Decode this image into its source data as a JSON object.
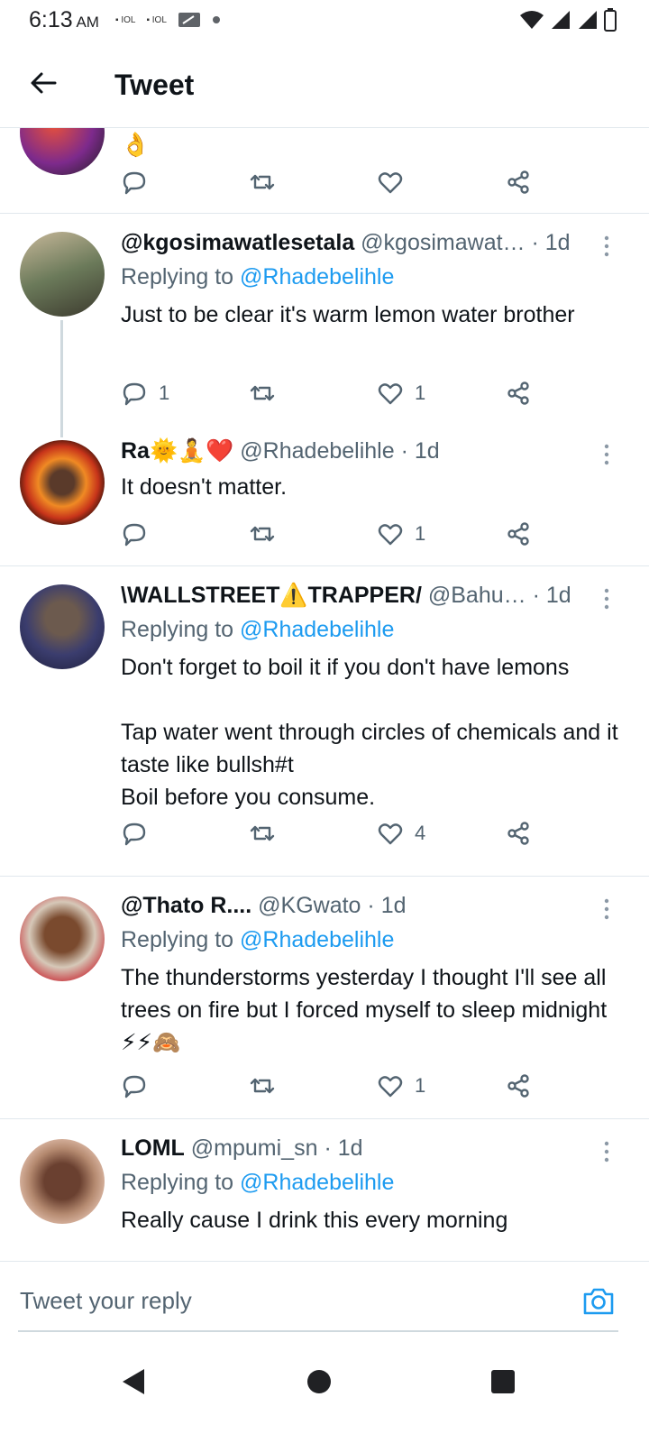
{
  "status_bar": {
    "time": "6:13",
    "ampm": "AM",
    "sim1": "IOL",
    "sim2": "IOL"
  },
  "header": {
    "title": "Tweet"
  },
  "partial_tweet": {
    "emoji": "👌"
  },
  "tweets": [
    {
      "name": "@kgosimawatlesetala",
      "handle": "@kgosimawat…",
      "time": "· 1d",
      "replying_label": "Replying to",
      "replying_to": "@Rhadebelihle",
      "text": "Just to be clear it's warm lemon water brother",
      "replies": "1",
      "retweets": "",
      "likes": "1"
    },
    {
      "name": "Ra🌞🧘❤️",
      "handle": "@Rhadebelihle",
      "time": "· 1d",
      "text": "It doesn't matter.",
      "replies": "",
      "retweets": "",
      "likes": "1"
    },
    {
      "name": "\\WALLSTREET⚠️TRAPPER/",
      "handle": "@Bahu…",
      "time": "· 1d",
      "replying_label": "Replying to",
      "replying_to": "@Rhadebelihle",
      "text": "Don't forget to boil it if you don't have lemons\n\nTap water went through circles of chemicals and it taste like bullsh#t\nBoil before you consume.",
      "replies": "",
      "retweets": "",
      "likes": "4"
    },
    {
      "name": "@Thato R....",
      "handle": "@KGwato",
      "time": "· 1d",
      "replying_label": "Replying to",
      "replying_to": "@Rhadebelihle",
      "text": "The thunderstorms yesterday I thought I'll see all trees on fire but I forced myself to sleep midnight ⚡⚡🙈",
      "replies": "",
      "retweets": "",
      "likes": "1"
    },
    {
      "name": "LOML",
      "handle": "@mpumi_sn",
      "time": "· 1d",
      "replying_label": "Replying to",
      "replying_to": "@Rhadebelihle",
      "text": "Really cause I drink this every morning",
      "replies": "",
      "retweets": "",
      "likes": ""
    }
  ],
  "reply_bar": {
    "placeholder": "Tweet your reply"
  },
  "icons": {
    "back": "arrow-left-icon",
    "reply": "comment-icon",
    "retweet": "retweet-icon",
    "like": "heart-icon",
    "share": "share-icon",
    "more": "vertical-dots-icon",
    "camera": "camera-icon"
  },
  "colors": {
    "accent": "#1d9bf0",
    "muted": "#536471",
    "text": "#0f1419",
    "divider": "#e1e8ed"
  }
}
